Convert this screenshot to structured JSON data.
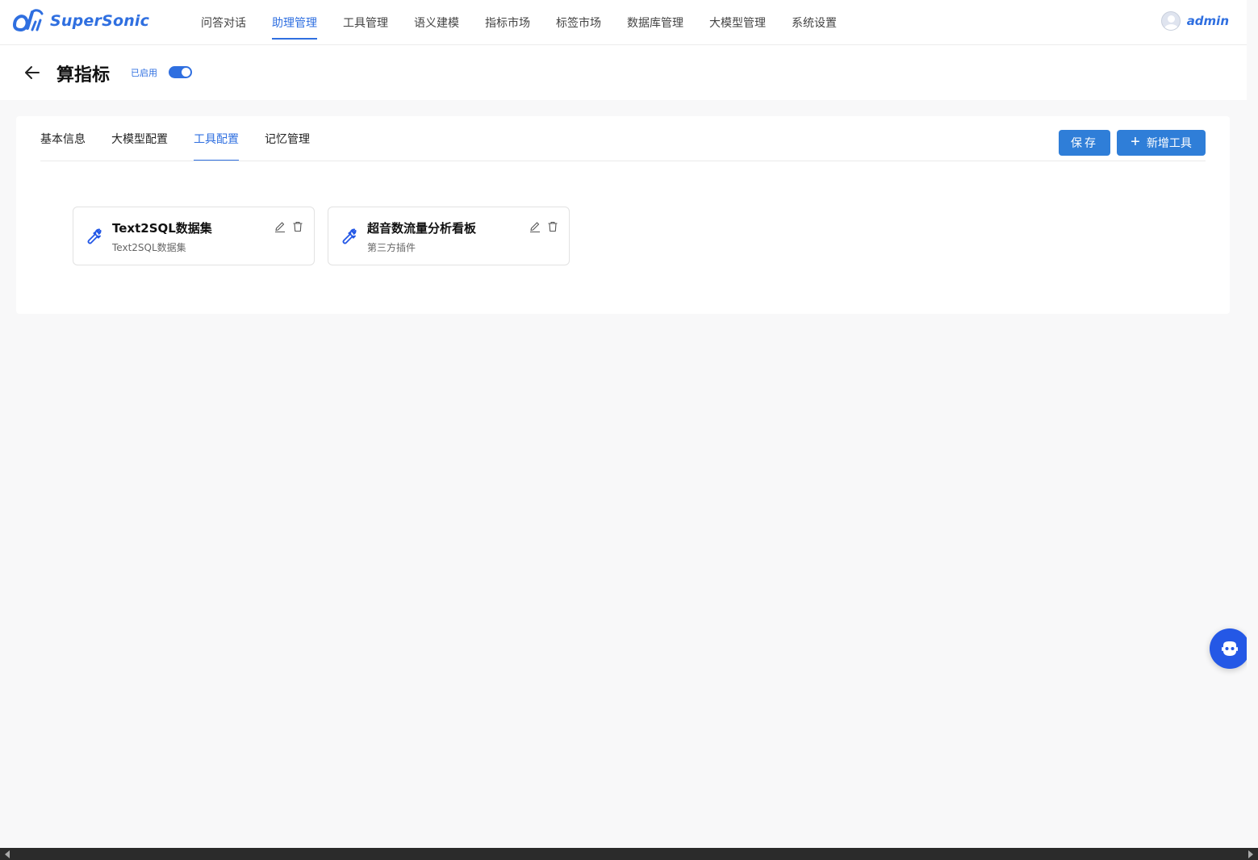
{
  "app": {
    "brand": "SuperSonic",
    "brand_color": "#2f6fe0"
  },
  "nav": {
    "items": [
      {
        "label": "问答对话",
        "active": false
      },
      {
        "label": "助理管理",
        "active": true
      },
      {
        "label": "工具管理",
        "active": false
      },
      {
        "label": "语义建模",
        "active": false
      },
      {
        "label": "指标市场",
        "active": false
      },
      {
        "label": "标签市场",
        "active": false
      },
      {
        "label": "数据库管理",
        "active": false
      },
      {
        "label": "大模型管理",
        "active": false
      },
      {
        "label": "系统设置",
        "active": false
      }
    ]
  },
  "user": {
    "name": "admin"
  },
  "page": {
    "title": "算指标",
    "status_label": "已启用",
    "enabled": true
  },
  "tabs": [
    {
      "label": "基本信息"
    },
    {
      "label": "大模型配置"
    },
    {
      "label": "工具配置",
      "active": true
    },
    {
      "label": "记忆管理"
    }
  ],
  "actions": {
    "save_label": "保存",
    "add_tool_label": "新增工具"
  },
  "tools": [
    {
      "name": "Text2SQL数据集",
      "description": "Text2SQL数据集"
    },
    {
      "name": "超音数流量分析看板",
      "description": "第三方插件"
    }
  ]
}
